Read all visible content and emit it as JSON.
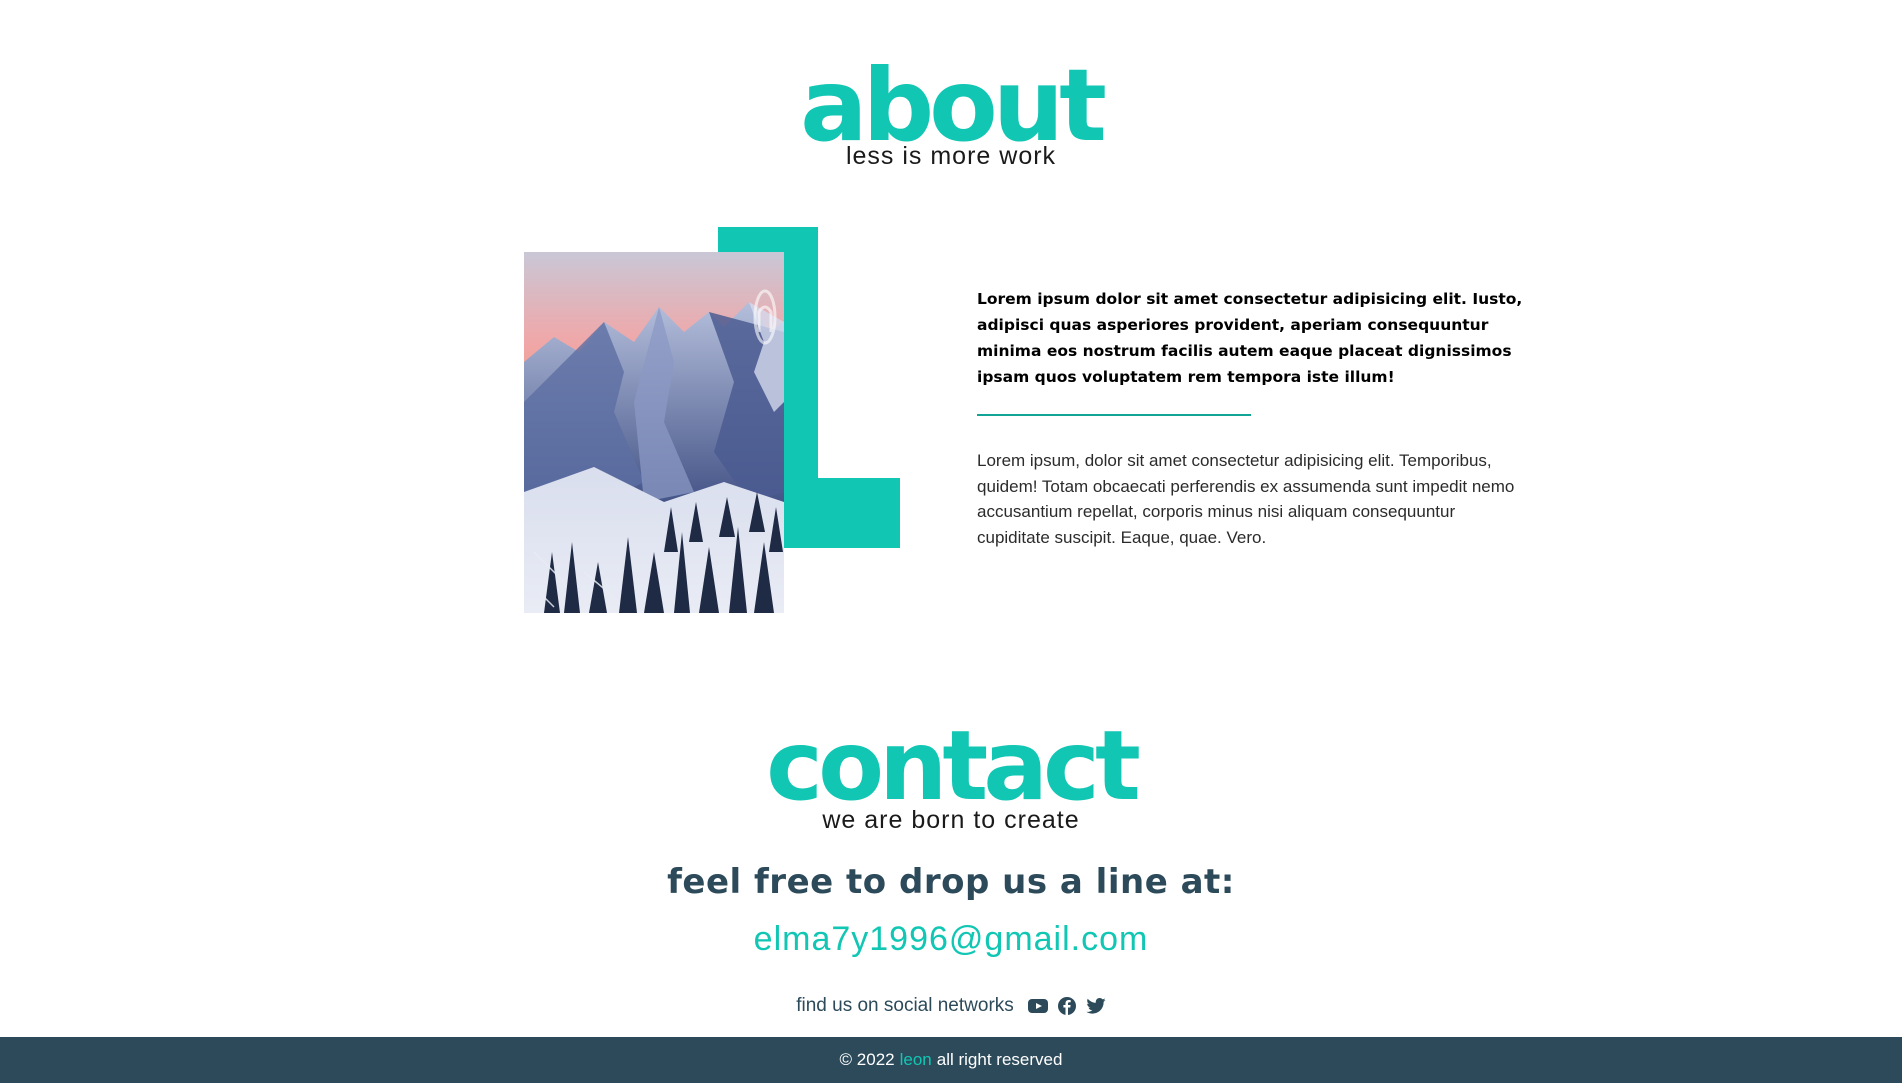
{
  "about": {
    "title": "about",
    "subtitle": "less is more work",
    "lead": "Lorem ipsum dolor sit amet consectetur adipisicing elit. Iusto, adipisci quas asperiores provident, aperiam consequuntur minima eos nostrum facilis autem eaque placeat dignissimos ipsam quos voluptatem rem tempora iste illum!",
    "body": "Lorem ipsum, dolor sit amet consectetur adipisicing elit. Temporibus, quidem! Totam obcaecati perferendis ex assumenda sunt impedit nemo accusantium repellat, corporis minus nisi aliquam consequuntur cupiditate suscipit. Eaque, quae. Vero."
  },
  "contact": {
    "title": "contact",
    "subtitle": "we are born to create",
    "drop_line": "feel free to drop us a line at:",
    "email": "elma7y1996@gmail.com",
    "social_label": "find us on social networks",
    "social_icons": [
      "youtube-icon",
      "facebook-icon",
      "twitter-icon"
    ]
  },
  "footer": {
    "prefix": "© 2022",
    "brand": "leon",
    "suffix": "all right reserved"
  },
  "colors": {
    "accent": "#12c6b4",
    "dark": "#2c4a5a"
  }
}
